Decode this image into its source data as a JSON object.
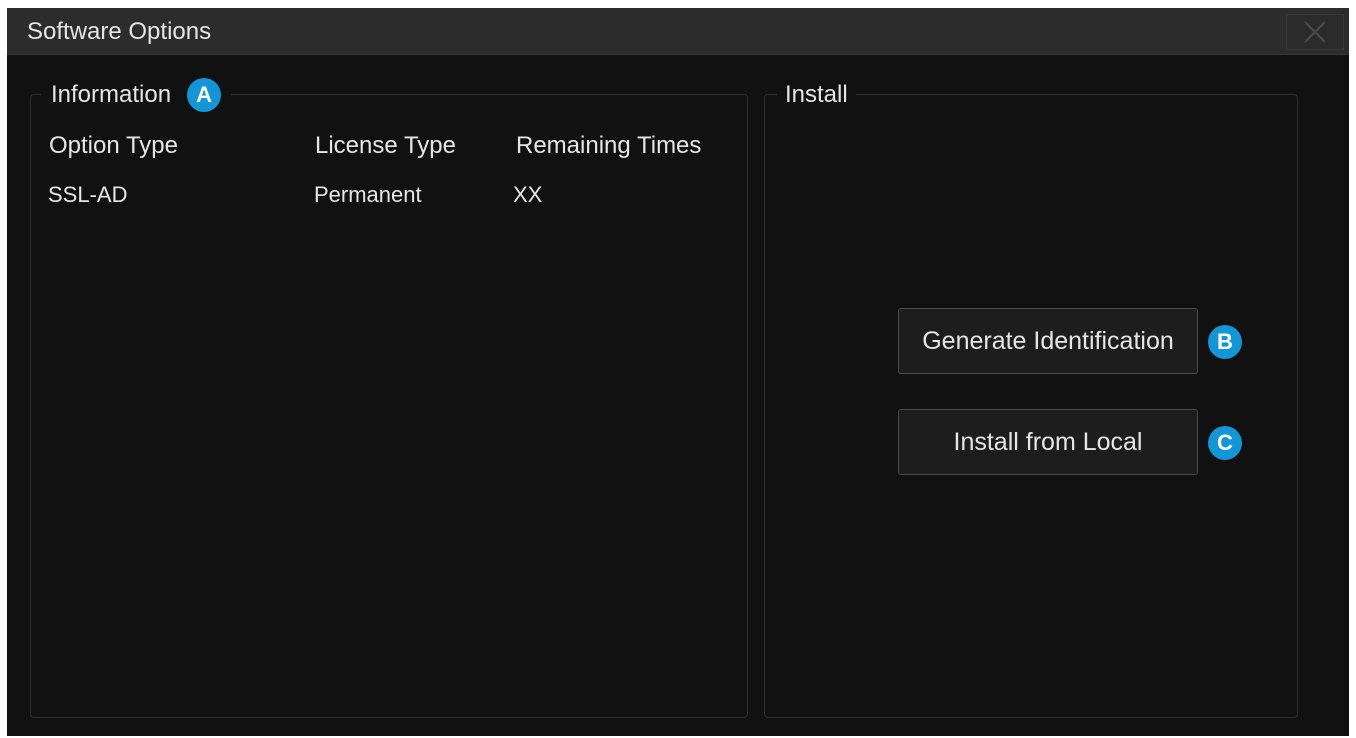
{
  "window": {
    "title": "Software Options"
  },
  "information": {
    "legend": "Information",
    "badge": "A",
    "columns": [
      "Option Type",
      "License Type",
      "Remaining Times"
    ],
    "rows": [
      [
        "SSL-AD",
        "Permanent",
        "XX"
      ]
    ]
  },
  "install": {
    "legend": "Install",
    "generate_label": "Generate Identification",
    "generate_badge": "B",
    "local_label": "Install from Local",
    "local_badge": "C"
  },
  "colors": {
    "background": "#111111",
    "titlebar": "#2c2c2c",
    "accent_badge": "#1296d8",
    "text": "#e6e6e6"
  },
  "icons": {
    "close": "close-icon"
  }
}
